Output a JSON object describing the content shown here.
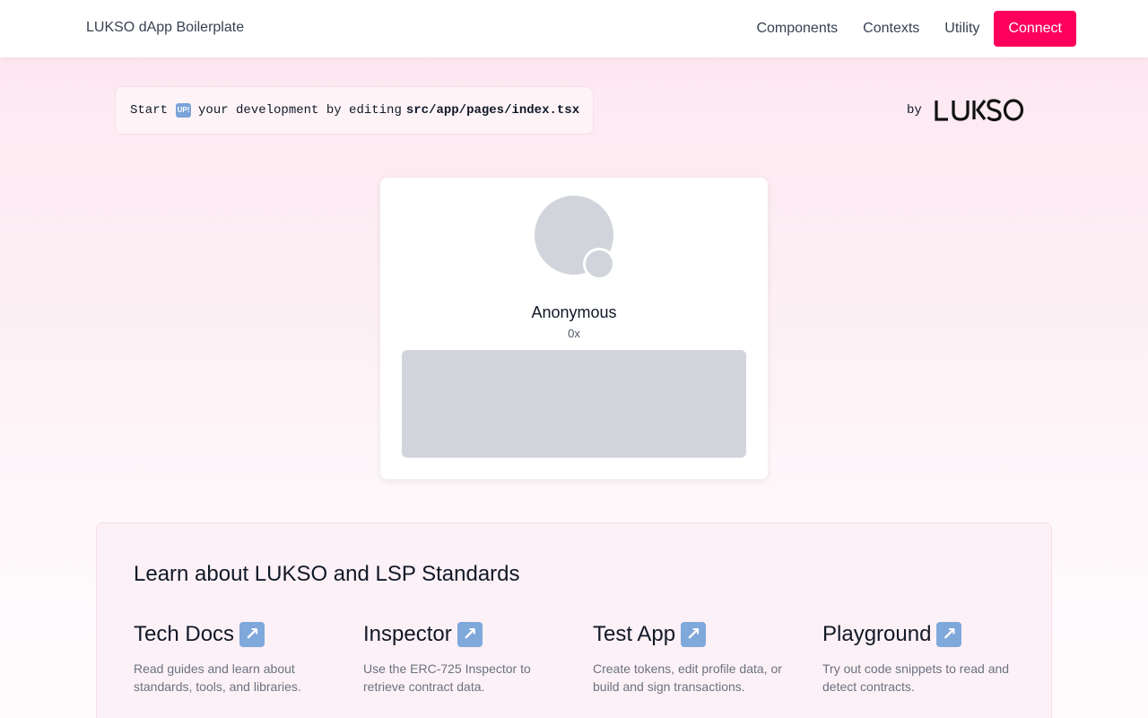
{
  "header": {
    "brand": "LUKSO dApp Boilerplate",
    "nav": [
      "Components",
      "Contexts",
      "Utility"
    ],
    "connect_label": "Connect",
    "accent_color": "#fe005b"
  },
  "banner": {
    "prefix": "Start",
    "icon_text": "UP!",
    "icon_name": "up-emoji-icon",
    "middle": "your development by editing",
    "path": "src/app/pages/index.tsx",
    "by": "by",
    "logo_text": "LUKSO"
  },
  "profile": {
    "name": "Anonymous",
    "address": "0x"
  },
  "learn": {
    "title": "Learn about LUKSO and LSP Standards",
    "items": [
      {
        "title": "Tech Docs",
        "description": "Read guides and learn about standards, tools, and libraries.",
        "icon": "external-link-arrow-icon"
      },
      {
        "title": "Inspector",
        "description": "Use the ERC-725 Inspector to retrieve contract data.",
        "icon": "external-link-arrow-icon"
      },
      {
        "title": "Test App",
        "description": "Create tokens, edit profile data, or build and sign transactions.",
        "icon": "external-link-arrow-icon"
      },
      {
        "title": "Playground",
        "description": "Try out code snippets to read and detect contracts.",
        "icon": "external-link-arrow-icon"
      }
    ]
  }
}
